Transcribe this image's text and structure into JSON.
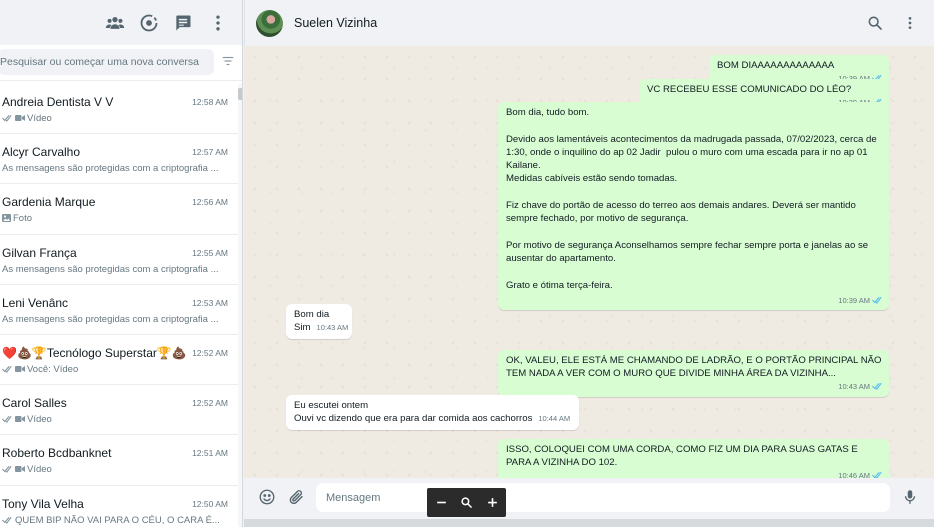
{
  "colors": {
    "outgoing_bubble": "#d9fdd3",
    "incoming_bubble": "#ffffff",
    "read_ticks": "#53bdeb",
    "chat_background": "#efeae2",
    "panel_header": "#f0f2f5"
  },
  "sidebar": {
    "header_icons": [
      "community-icon",
      "status-icon",
      "new-chat-icon",
      "menu-icon"
    ],
    "search": {
      "placeholder": "Pesquisar ou começar uma nova conversa",
      "value": ""
    },
    "filter_icon": "filter-icon",
    "chats": [
      {
        "name": "Andreia Dentista V V",
        "time": "12:58 AM",
        "preview": "Vídeo",
        "ticks": true,
        "prefix_icon": "video-icon"
      },
      {
        "name": "Alcyr Carvalho",
        "time": "12:57 AM",
        "preview": "As mensagens são protegidas com a criptografia ..."
      },
      {
        "name": "Gardenia Marque",
        "time": "12:56 AM",
        "preview": "Foto",
        "prefix_icon": "photo-icon"
      },
      {
        "name": "Gilvan França",
        "time": "12:55 AM",
        "preview": "As mensagens são protegidas com a criptografia ..."
      },
      {
        "name": "Leni Venânc",
        "time": "12:53 AM",
        "preview": "As mensagens são protegidas com a criptografia ..."
      },
      {
        "name": "❤️💩🏆Tecnólogo Superstar🏆💩...",
        "time": "12:52 AM",
        "preview": "Você: Vídeo",
        "ticks": true,
        "prefix_icon": "video-icon"
      },
      {
        "name": "Carol Salles",
        "time": "12:52 AM",
        "preview": "Vídeo",
        "ticks": true,
        "prefix_icon": "video-icon"
      },
      {
        "name": "Roberto Bcdbanknet",
        "time": "12:51 AM",
        "preview": "Vídeo",
        "ticks": true,
        "prefix_icon": "video-icon"
      },
      {
        "name": "Tony Vila Velha",
        "time": "12:50 AM",
        "preview": "QUEM BIP NÃO VAI PARA O CÉU, O CARA É...",
        "ticks": true
      }
    ]
  },
  "conversation": {
    "contact_name": "Suelen Vizinha",
    "messages": [
      {
        "direction": "out",
        "text": "BOM DIAAAAAAAAAAAAA",
        "time": "10:39 AM",
        "read": true
      },
      {
        "direction": "out",
        "text": "VC RECEBEU ESSE COMUNICADO DO LÉO?",
        "time": "10:39 AM",
        "read": true
      },
      {
        "direction": "out",
        "text": "Bom dia, tudo bom.\n\nDevido aos lamentáveis acontecimentos da madrugada passada, 07/02/2023, cerca de 1:30, onde o inquilino do ap 02 Jadir  pulou o muro com uma escada para ir no ap 01 Kailane.\nMedidas cabíveis estão sendo tomadas.\n\nFiz chave do portão de acesso do terreo aos demais andares. Deverá ser mantido sempre fechado, por motivo de segurança.\n\nPor motivo de segurança Aconselhamos sempre fechar sempre porta e janelas ao se ausentar do apartamento.\n\nGrato e ótima terça-feira.",
        "time": "10:39 AM",
        "read": true
      },
      {
        "direction": "in",
        "text": "Bom dia\nSim",
        "time": "10:43 AM"
      },
      {
        "direction": "out",
        "text": "OK, VALEU, ELE ESTÁ ME CHAMANDO DE LADRÃO, E O PORTÃO PRINCIPAL NÃO TEM NADA A VER COM O MURO QUE DIVIDE MINHA ÁREA DA VIZINHA...",
        "time": "10:43 AM",
        "read": true
      },
      {
        "direction": "in",
        "text": "Eu escutei ontem\nOuvi vc dizendo que era para dar comida aos cachorros",
        "time": "10:44 AM"
      },
      {
        "direction": "out",
        "text": "ISSO, COLOQUEI COM UMA CORDA, COMO FIZ UM DIA PARA SUAS GATAS E PARA A VIZINHA DO 102.",
        "time": "10:46 AM",
        "read": true
      }
    ],
    "header_icons": [
      "search-icon",
      "menu-icon"
    ]
  },
  "composer": {
    "placeholder": "Mensagem",
    "value": "",
    "icons": [
      "emoji-icon",
      "attach-icon",
      "mic-icon"
    ]
  },
  "zoom_toolbar": {
    "buttons": [
      "zoom-out-icon",
      "zoom-search-icon",
      "zoom-in-icon"
    ]
  }
}
